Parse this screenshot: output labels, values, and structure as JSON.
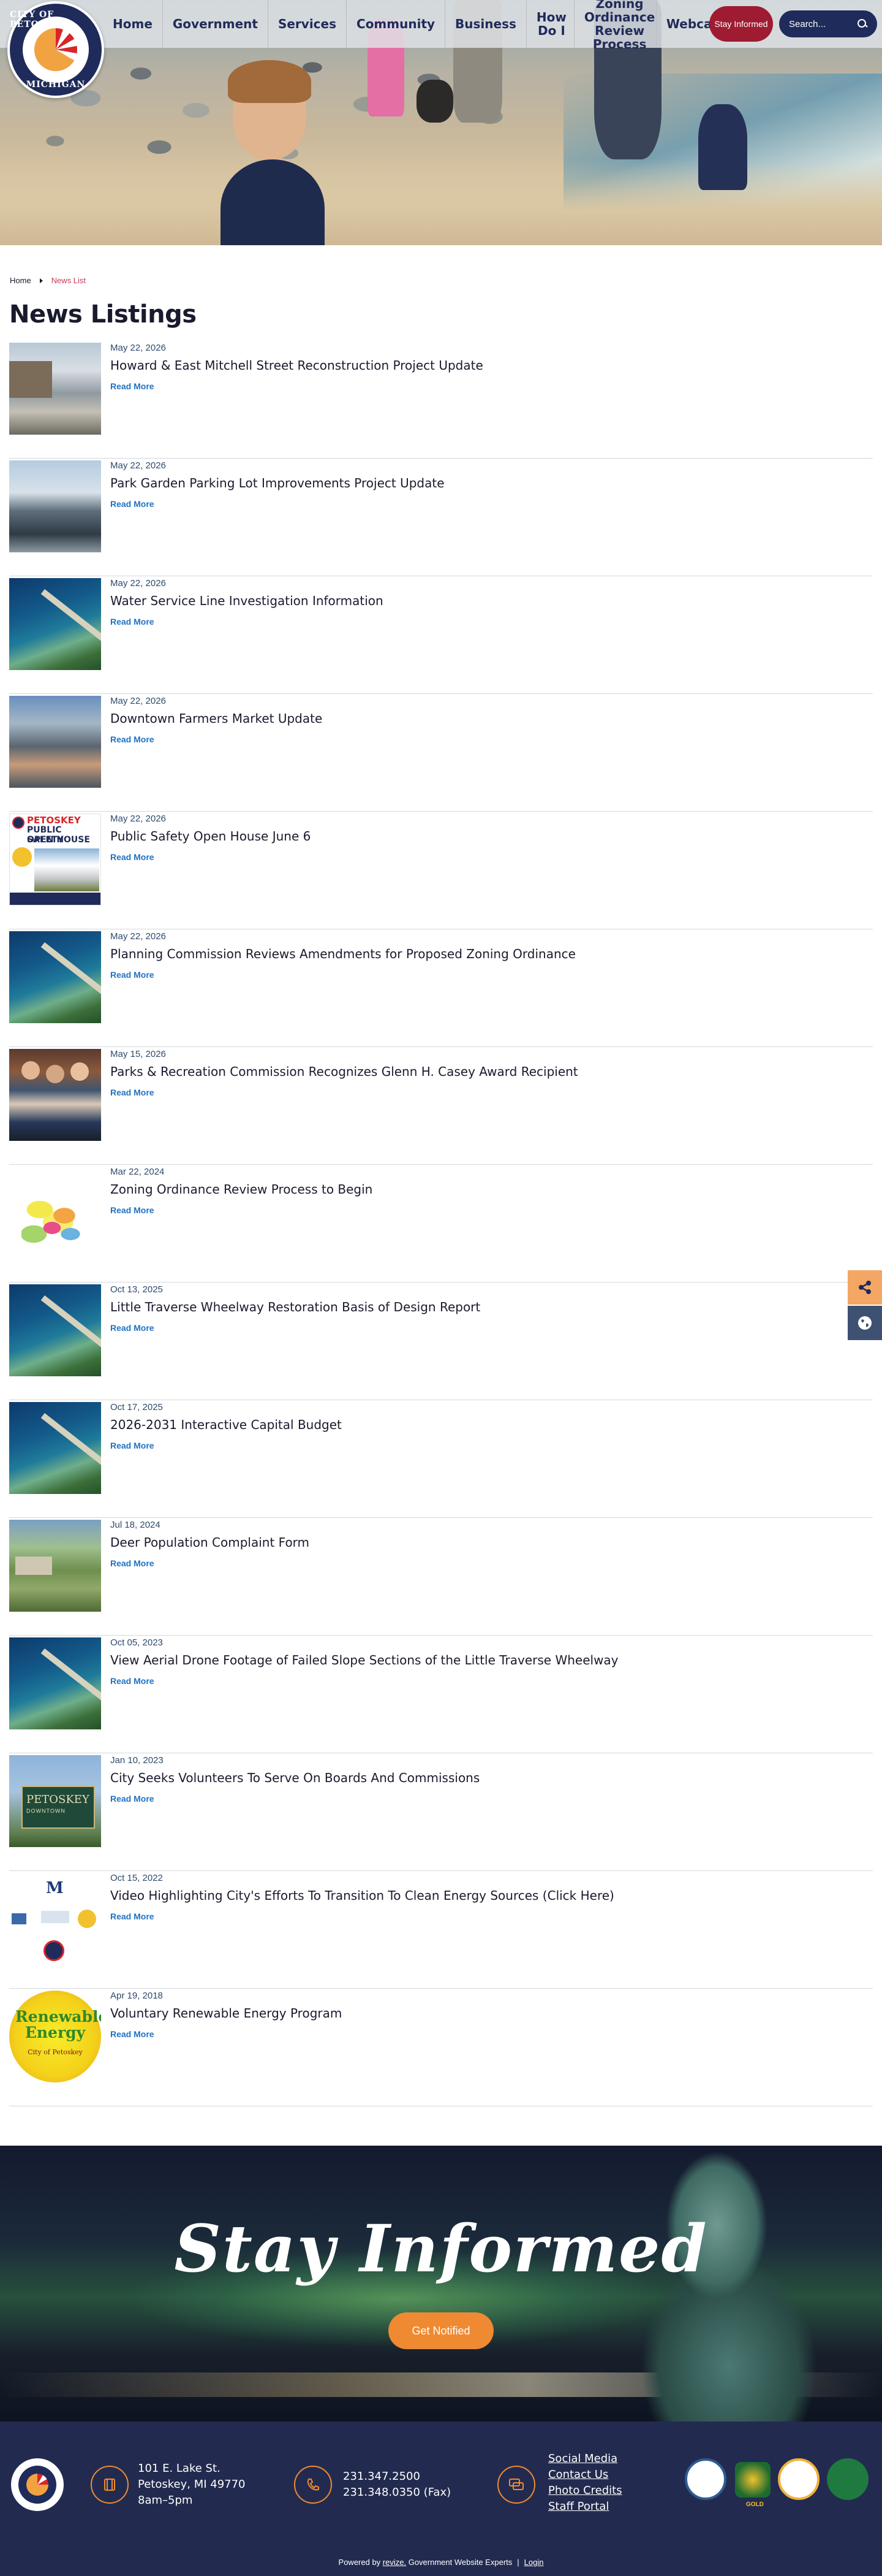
{
  "header": {
    "logo": {
      "text_top": "CITY OF PETOSKEY",
      "text_bottom": "MICHIGAN"
    },
    "nav": [
      {
        "label": "Home"
      },
      {
        "label": "Government"
      },
      {
        "label": "Services"
      },
      {
        "label": "Community"
      },
      {
        "label": "Business"
      },
      {
        "label": "How Do I"
      },
      {
        "label": "Zoning Ordinance Review Process"
      },
      {
        "label": "Webcams"
      }
    ],
    "stay_informed_label": "Stay Informed",
    "search": {
      "placeholder": "Search..."
    }
  },
  "breadcrumb": {
    "home": "Home",
    "current": "News List"
  },
  "page_title": "News Listings",
  "read_more_label": "Read More",
  "news": [
    {
      "date": "May 22, 2026",
      "title": "Howard & East Mitchell Street Reconstruction Project Update",
      "thumb": "street"
    },
    {
      "date": "May 22, 2026",
      "title": "Park Garden Parking Lot Improvements Project Update",
      "thumb": "parking"
    },
    {
      "date": "May 22, 2026",
      "title": "Water Service Line Investigation Information",
      "thumb": "aerial"
    },
    {
      "date": "May 22, 2026",
      "title": "Downtown Farmers Market Update",
      "thumb": "market"
    },
    {
      "date": "May 22, 2026",
      "title": "Public Safety Open House June 6",
      "thumb": "open-house"
    },
    {
      "date": "May 22, 2026",
      "title": "Planning Commission Reviews Amendments for Proposed Zoning Ordinance",
      "thumb": "aerial"
    },
    {
      "date": "May 15, 2026",
      "title": "Parks & Recreation Commission Recognizes Glenn H. Casey Award Recipient",
      "thumb": "people"
    },
    {
      "date": "Mar 22, 2024",
      "title": "Zoning Ordinance Review Process to Begin",
      "thumb": "map"
    },
    {
      "date": "Oct 13, 2025",
      "title": "Little Traverse Wheelway Restoration Basis of Design Report",
      "thumb": "aerial"
    },
    {
      "date": "Oct 17, 2025",
      "title": "2026-2031 Interactive Capital Budget",
      "thumb": "aerial"
    },
    {
      "date": "Jul 18, 2024",
      "title": "Deer Population Complaint Form",
      "thumb": "lawn"
    },
    {
      "date": "Oct 05, 2023",
      "title": "View Aerial Drone Footage of Failed Slope Sections of the Little Traverse Wheelway",
      "thumb": "aerial"
    },
    {
      "date": "Jan 10, 2023",
      "title": "City Seeks Volunteers To Serve On Boards And Commissions",
      "thumb": "sign"
    },
    {
      "date": "Oct 15, 2022",
      "title": "Video Highlighting City's Efforts To Transition To Clean Energy Sources (Click Here)",
      "thumb": "logos"
    },
    {
      "date": "Apr 19, 2018",
      "title": "Voluntary Renewable Energy Program",
      "thumb": "renewable"
    }
  ],
  "thumb_text": {
    "open_house": {
      "line1": "PETOSKEY",
      "line2": "PUBLIC SAFETY",
      "line3": "OPEN HOUSE"
    },
    "sign": {
      "line1": "PETOSKEY",
      "line2": "DOWNTOWN"
    },
    "renewable": {
      "line1": "Renewable",
      "line2": "Energy",
      "line3": "City of Petoskey"
    },
    "logos": {
      "letter": "M"
    }
  },
  "stay_informed": {
    "title": "Stay Informed",
    "button": "Get Notified"
  },
  "footer": {
    "address": [
      "101 E. Lake St.",
      "Petoskey, MI 49770",
      "8am–5pm"
    ],
    "phones": [
      "231.347.2500",
      "231.348.0350 (Fax)"
    ],
    "links": [
      "Social Media",
      "Contact Us",
      "Photo Credits",
      "Staff Portal"
    ],
    "badge_text": "GOLD",
    "powered_prefix": "Powered by ",
    "powered_brand": "revize.",
    "powered_suffix": " Government Website Experts",
    "login": "Login"
  },
  "colors": {
    "navy": "#1f2b5a",
    "accent_red": "#9e1b32",
    "accent_orange": "#ef8a32",
    "link_blue": "#1f72c4",
    "footer_bg": "#222b4f"
  },
  "icons": [
    "search-icon",
    "share-icon",
    "globe-icon",
    "location-icon",
    "phone-icon",
    "chat-icon",
    "breadcrumb-arrow-icon"
  ]
}
